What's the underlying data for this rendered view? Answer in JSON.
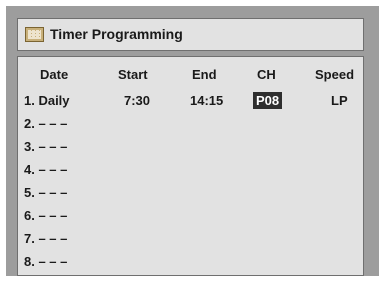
{
  "title": "Timer Programming",
  "columns": {
    "date": "Date",
    "start": "Start",
    "end": "End",
    "ch": "CH",
    "speed": "Speed"
  },
  "rows": [
    {
      "label": "1. Daily",
      "start": "7:30",
      "end": "14:15",
      "ch": "P08",
      "speed": "LP"
    },
    {
      "label": "2. – – –"
    },
    {
      "label": "3. – – –"
    },
    {
      "label": "4. – – –"
    },
    {
      "label": "5. – – –"
    },
    {
      "label": "6. – – –"
    },
    {
      "label": "7. – – –"
    },
    {
      "label": "8. – – –"
    }
  ],
  "colors": {
    "panel": "#e2e2e2",
    "frame": "#9d9d9d",
    "selected_bg": "#2e2e2e"
  }
}
